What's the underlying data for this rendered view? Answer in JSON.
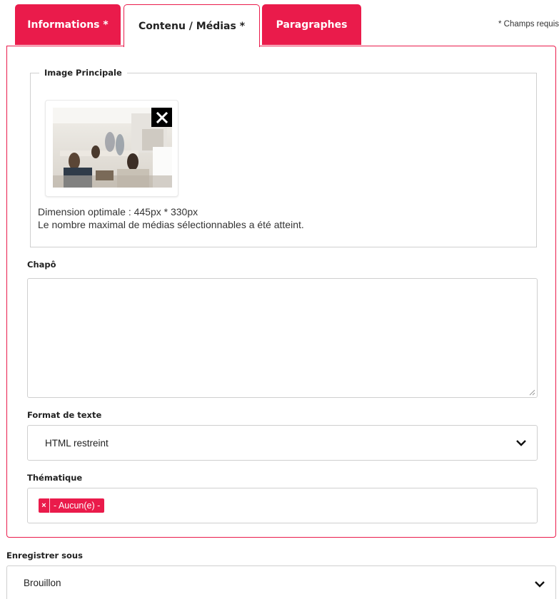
{
  "tabs": [
    {
      "label": "Informations *"
    },
    {
      "label": "Contenu / Médias *"
    },
    {
      "label": "Paragraphes"
    }
  ],
  "required_note": "* Champs requis",
  "image_section": {
    "legend": "Image Principale",
    "dimension_text": "Dimension optimale : 445px * 330px",
    "limit_text": "Le nombre maximal de médias sélectionnables a été atteint."
  },
  "chapo": {
    "label": "Chapô",
    "value": ""
  },
  "format": {
    "label": "Format de texte",
    "selected": "HTML restreint"
  },
  "thematique": {
    "label": "Thématique",
    "tag": "- Aucun(e) -",
    "tag_remove": "×"
  },
  "enregistrer": {
    "label": "Enregistrer sous",
    "selected": "Brouillon"
  },
  "colors": {
    "accent": "#ea1b4b",
    "border": "#cfcfcf"
  },
  "icons": [
    "close-icon",
    "chevron-down-icon",
    "resize-grip-icon"
  ]
}
